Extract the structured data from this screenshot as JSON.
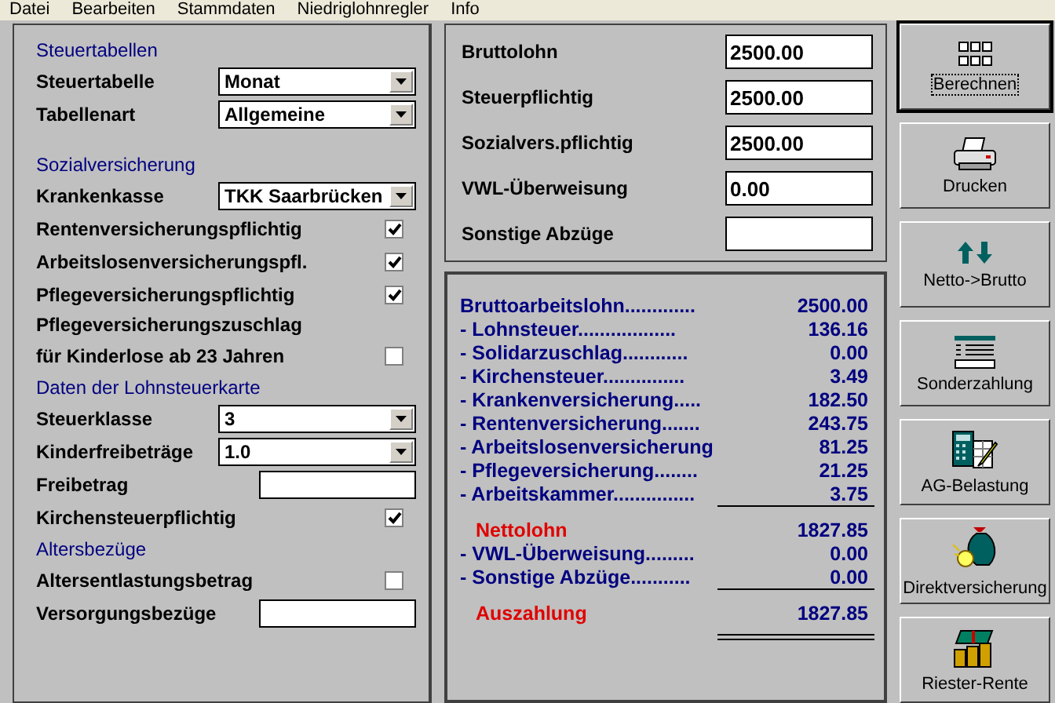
{
  "menu": [
    {
      "label": "Datei"
    },
    {
      "label": "Bearbeiten"
    },
    {
      "label": "Stammdaten"
    },
    {
      "label": "Niedriglohnregler"
    },
    {
      "label": "Info"
    }
  ],
  "settings": [
    {
      "kind": "heading",
      "label": "Steuertabellen"
    },
    {
      "kind": "select",
      "label": "Steuertabelle",
      "value": "Monat"
    },
    {
      "kind": "select",
      "label": "Tabellenart",
      "value": "Allgemeine"
    },
    {
      "kind": "spacer"
    },
    {
      "kind": "heading",
      "label": "Sozialversicherung"
    },
    {
      "kind": "select",
      "label": "Krankenkasse",
      "value": "TKK Saarbrücken"
    },
    {
      "kind": "checkbox",
      "label": "Rentenversicherungspflichtig",
      "checked": true
    },
    {
      "kind": "checkbox",
      "label": "Arbeitslosenversicherungspfl.",
      "checked": true
    },
    {
      "kind": "checkbox",
      "label": "Pflegeversicherungspflichtig",
      "checked": true
    },
    {
      "kind": "text",
      "label": "Pflegeversicherungszuschlag"
    },
    {
      "kind": "checkbox",
      "label": "für Kinderlose ab 23 Jahren",
      "checked": false
    },
    {
      "kind": "heading",
      "label": "Daten der Lohnsteuerkarte"
    },
    {
      "kind": "select",
      "label": "Steuerklasse",
      "value": "3"
    },
    {
      "kind": "select",
      "label": "Kinderfreibeträge",
      "value": "1.0"
    },
    {
      "kind": "input",
      "label": "Freibetrag"
    },
    {
      "kind": "checkbox",
      "label": "Kirchensteuerpflichtig",
      "checked": true
    },
    {
      "kind": "heading",
      "label": "Altersbezüge"
    },
    {
      "kind": "checkbox",
      "label": "Altersentlastungsbetrag",
      "checked": false
    },
    {
      "kind": "input",
      "label": "Versorgungsbezüge"
    }
  ],
  "inputs": [
    {
      "label": "Bruttolohn",
      "value": "2500.00"
    },
    {
      "label": "Steuerpflichtig",
      "value": "2500.00"
    },
    {
      "label": "Sozialvers.pflichtig",
      "value": "2500.00"
    },
    {
      "label": "VWL-Überweisung",
      "value": "0.00"
    },
    {
      "label": "Sonstige Abzüge"
    }
  ],
  "results": [
    {
      "kind": "item",
      "label": "Bruttoarbeitslohn.............",
      "amount": "2500.00"
    },
    {
      "kind": "item",
      "label": "- Lohnsteuer..................",
      "amount": "136.16"
    },
    {
      "kind": "item",
      "label": "- Solidarzuschlag............",
      "amount": "0.00"
    },
    {
      "kind": "item",
      "label": "- Kirchensteuer...............",
      "amount": "3.49"
    },
    {
      "kind": "item",
      "label": "- Krankenversicherung.....",
      "amount": "182.50"
    },
    {
      "kind": "item",
      "label": "- Rentenversicherung.......",
      "amount": "243.75"
    },
    {
      "kind": "item",
      "label": "- Arbeitslosenversicherung",
      "amount": "81.25"
    },
    {
      "kind": "item",
      "label": "- Pflegeversicherung........",
      "amount": "21.25"
    },
    {
      "kind": "item",
      "label": "- Arbeitskammer...............",
      "amount": "3.75"
    },
    {
      "kind": "rule"
    },
    {
      "kind": "total",
      "label": "Nettolohn",
      "amount": "1827.85"
    },
    {
      "kind": "item",
      "label": "- VWL-Überweisung.........",
      "amount": "0.00"
    },
    {
      "kind": "item",
      "label": "- Sonstige Abzüge...........",
      "amount": "0.00"
    },
    {
      "kind": "rule"
    },
    {
      "kind": "total",
      "label": "Auszahlung",
      "amount": "1827.85"
    },
    {
      "kind": "double_rule"
    }
  ],
  "actions": [
    {
      "label": "Berechnen",
      "selected": true
    },
    {
      "label": "Drucken",
      "selected": false
    },
    {
      "label": "Netto->Brutto",
      "selected": false
    },
    {
      "label": "Sonderzahlung",
      "selected": false
    },
    {
      "label": "AG-Belastung",
      "selected": false
    },
    {
      "label": "Direktversicherung",
      "selected": false
    },
    {
      "label": "Riester-Rente",
      "selected": false
    }
  ]
}
